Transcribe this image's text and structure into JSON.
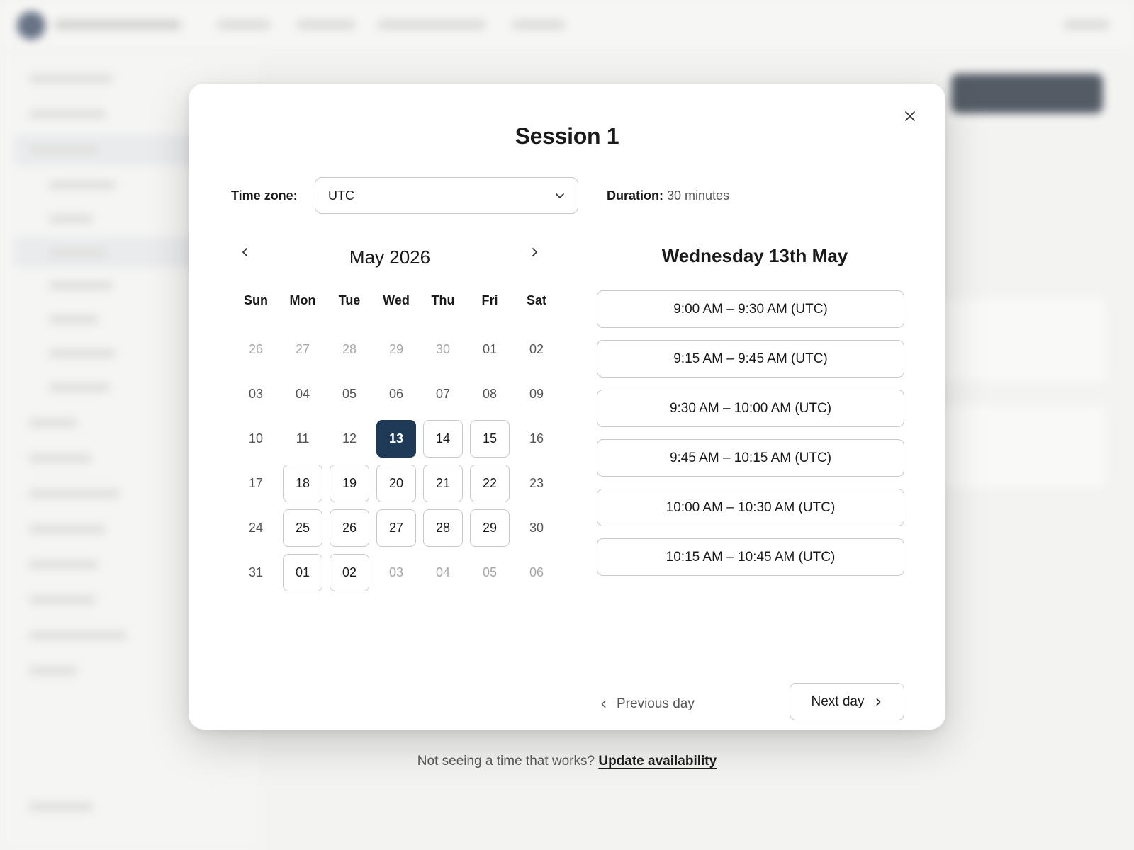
{
  "modal": {
    "title": "Session 1",
    "close_icon": "close-icon",
    "timezone_label": "Time zone:",
    "timezone_value": "UTC",
    "duration_label": "Duration:",
    "duration_value": "30 minutes"
  },
  "calendar": {
    "month_label": "May 2026",
    "weekdays": [
      "Sun",
      "Mon",
      "Tue",
      "Wed",
      "Thu",
      "Fri",
      "Sat"
    ],
    "days": [
      {
        "label": "26",
        "state": "muted"
      },
      {
        "label": "27",
        "state": "muted"
      },
      {
        "label": "28",
        "state": "muted"
      },
      {
        "label": "29",
        "state": "muted"
      },
      {
        "label": "30",
        "state": "muted"
      },
      {
        "label": "01",
        "state": "plain"
      },
      {
        "label": "02",
        "state": "plain"
      },
      {
        "label": "03",
        "state": "plain"
      },
      {
        "label": "04",
        "state": "plain"
      },
      {
        "label": "05",
        "state": "plain"
      },
      {
        "label": "06",
        "state": "plain"
      },
      {
        "label": "07",
        "state": "plain"
      },
      {
        "label": "08",
        "state": "plain"
      },
      {
        "label": "09",
        "state": "plain"
      },
      {
        "label": "10",
        "state": "plain"
      },
      {
        "label": "11",
        "state": "plain"
      },
      {
        "label": "12",
        "state": "plain"
      },
      {
        "label": "13",
        "state": "selected"
      },
      {
        "label": "14",
        "state": "avail"
      },
      {
        "label": "15",
        "state": "avail"
      },
      {
        "label": "16",
        "state": "plain"
      },
      {
        "label": "17",
        "state": "plain"
      },
      {
        "label": "18",
        "state": "avail"
      },
      {
        "label": "19",
        "state": "avail"
      },
      {
        "label": "20",
        "state": "avail"
      },
      {
        "label": "21",
        "state": "avail"
      },
      {
        "label": "22",
        "state": "avail"
      },
      {
        "label": "23",
        "state": "plain"
      },
      {
        "label": "24",
        "state": "plain"
      },
      {
        "label": "25",
        "state": "avail"
      },
      {
        "label": "26",
        "state": "avail"
      },
      {
        "label": "27",
        "state": "avail"
      },
      {
        "label": "28",
        "state": "avail"
      },
      {
        "label": "29",
        "state": "avail"
      },
      {
        "label": "30",
        "state": "plain"
      },
      {
        "label": "31",
        "state": "plain"
      },
      {
        "label": "01",
        "state": "avail"
      },
      {
        "label": "02",
        "state": "avail"
      },
      {
        "label": "03",
        "state": "muted"
      },
      {
        "label": "04",
        "state": "muted"
      },
      {
        "label": "05",
        "state": "muted"
      },
      {
        "label": "06",
        "state": "muted"
      }
    ]
  },
  "slots": {
    "date_label": "Wednesday 13th May",
    "items": [
      "9:00 AM – 9:30 AM (UTC)",
      "9:15 AM – 9:45 AM (UTC)",
      "9:30 AM – 10:00 AM (UTC)",
      "9:45 AM – 10:15 AM (UTC)",
      "10:00 AM – 10:30 AM (UTC)",
      "10:15 AM – 10:45 AM (UTC)"
    ],
    "prev_day_label": "Previous day",
    "next_day_label": "Next day"
  },
  "footer": {
    "question": "Not seeing a time that works?",
    "link_label": "Update availability"
  },
  "colors": {
    "selected_day": "#1e3a56",
    "border": "#c9c9c9",
    "muted_text": "#a8a8a8"
  }
}
